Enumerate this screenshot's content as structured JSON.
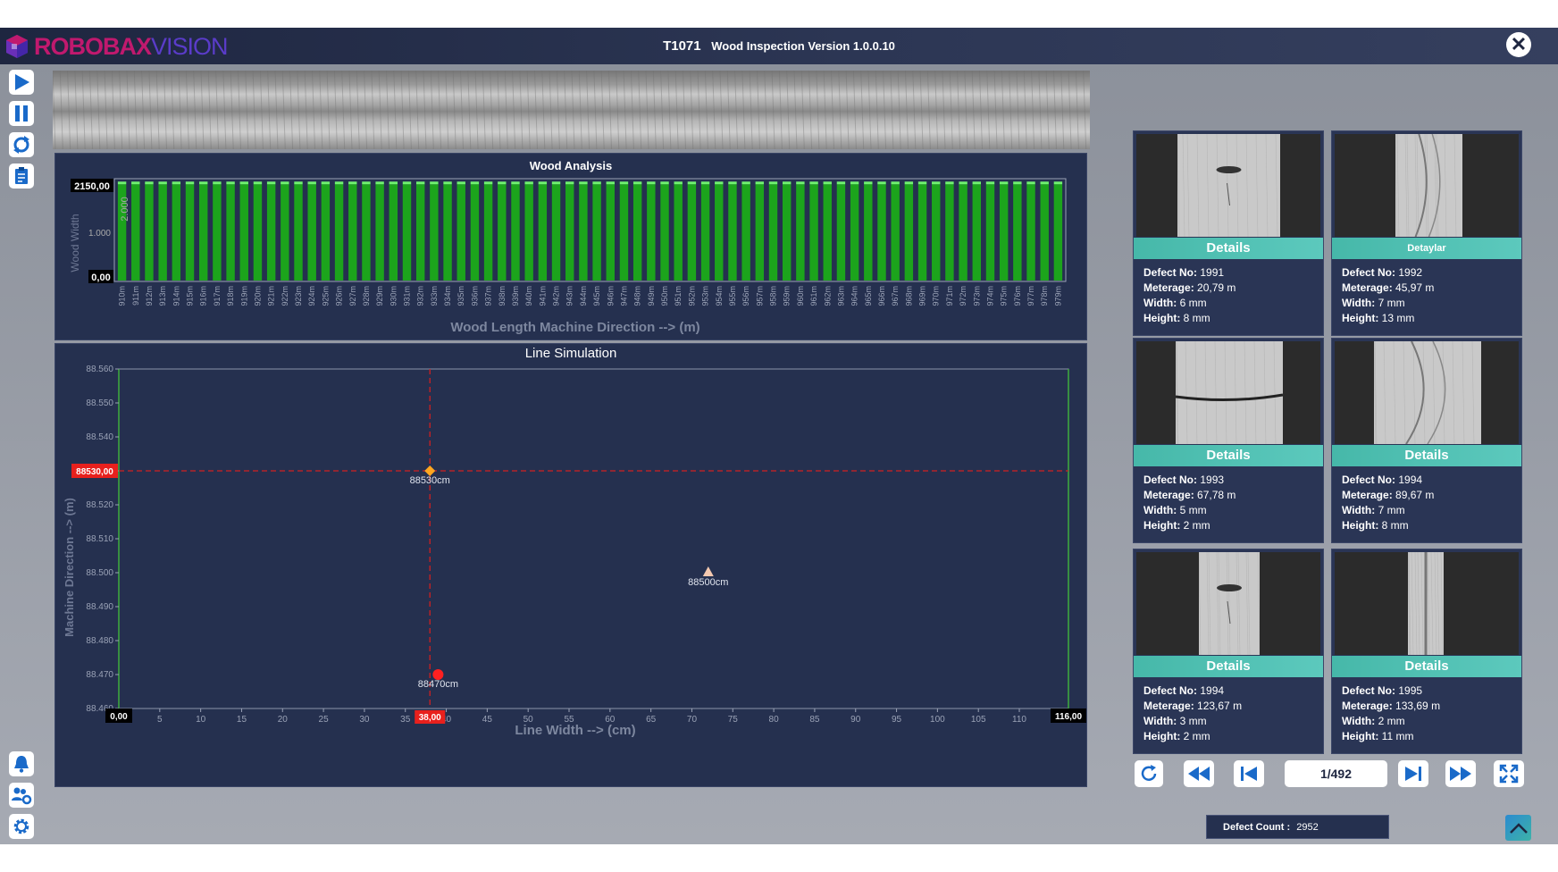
{
  "app": {
    "logo_primary": "ROBOBAX",
    "logo_secondary": "VISION",
    "code": "T1071",
    "title": "Wood Inspection Version 1.0.0.10",
    "close_label": "✕"
  },
  "sidebar": {
    "icons": [
      "play-icon",
      "pause-icon",
      "refresh-icon",
      "report-icon",
      "bell-icon",
      "users-settings-icon",
      "gear-icon"
    ]
  },
  "wood_analysis": {
    "title": "Wood Analysis",
    "ylabel": "Wood Width",
    "xlabel": "Wood Length Machine Direction --> (m)",
    "y_max_label": "2150,00",
    "y_min_label": "0,00",
    "y_mid_label": "1.000",
    "y_top_hidden": "2.000",
    "bar_color": "#1ca41c",
    "bar_top_color": "#6ff06f"
  },
  "chart_data": [
    {
      "type": "bar",
      "title": "Wood Analysis",
      "xlabel": "Wood Length Machine Direction --> (m)",
      "ylabel": "Wood Width",
      "ylim": [
        0,
        2150
      ],
      "categories": [
        "910m",
        "911m",
        "912m",
        "913m",
        "914m",
        "915m",
        "916m",
        "917m",
        "918m",
        "919m",
        "920m",
        "921m",
        "922m",
        "923m",
        "924m",
        "925m",
        "926m",
        "927m",
        "928m",
        "929m",
        "930m",
        "931m",
        "932m",
        "933m",
        "934m",
        "935m",
        "936m",
        "937m",
        "938m",
        "939m",
        "940m",
        "941m",
        "942m",
        "943m",
        "944m",
        "945m",
        "946m",
        "947m",
        "948m",
        "949m",
        "950m",
        "951m",
        "952m",
        "953m",
        "954m",
        "955m",
        "956m",
        "957m",
        "958m",
        "959m",
        "960m",
        "961m",
        "962m",
        "963m",
        "964m",
        "965m",
        "966m",
        "967m",
        "968m",
        "969m",
        "970m",
        "971m",
        "972m",
        "973m",
        "974m",
        "975m",
        "976m",
        "977m",
        "978m",
        "979m"
      ],
      "bar_value": 2050
    },
    {
      "type": "scatter",
      "title": "Line Simulation",
      "xlabel": "Line Width --> (cm)",
      "ylabel": "Machine Direction --> (m)",
      "xlim": [
        0,
        116
      ],
      "ylim": [
        88.46,
        88.56
      ],
      "x_end_label": "116,00",
      "x_start_label": "0,00",
      "x_ticks": [
        5,
        10,
        15,
        20,
        25,
        30,
        35,
        40,
        45,
        50,
        55,
        60,
        65,
        70,
        75,
        80,
        85,
        90,
        95,
        100,
        105,
        110
      ],
      "y_ticks": [
        "88.560",
        "88.550",
        "88.540",
        "88.530",
        "88.520",
        "88.510",
        "88.500",
        "88.490",
        "88.480",
        "88.470",
        "88.460"
      ],
      "cursor": {
        "x": 38,
        "y": 88.53,
        "x_label": "38,00",
        "y_label": "88530,00"
      },
      "points": [
        {
          "x": 38,
          "y": 88.53,
          "label": "88530cm",
          "shape": "diamond",
          "color": "#ffa620"
        },
        {
          "x": 72,
          "y": 88.5,
          "label": "88500cm",
          "shape": "triangle",
          "color": "#f4c9b0"
        },
        {
          "x": 39,
          "y": 88.47,
          "label": "88470cm",
          "shape": "circle",
          "color": "#ff2020"
        }
      ]
    }
  ],
  "defects": [
    {
      "details": "Details",
      "no": "1991",
      "meterage": "20,79 m",
      "width": "6 mm",
      "height": "8 mm"
    },
    {
      "details": "Detaylar",
      "no": "1992",
      "meterage": "45,97 m",
      "width": "7 mm",
      "height": "13 mm"
    },
    {
      "details": "Details",
      "no": "1993",
      "meterage": "67,78 m",
      "width": "5 mm",
      "height": "2 mm"
    },
    {
      "details": "Details",
      "no": "1994",
      "meterage": "89,67 m",
      "width": "7 mm",
      "height": "8 mm"
    },
    {
      "details": "Details",
      "no": "1994",
      "meterage": "123,67 m",
      "width": "3 mm",
      "height": "2 mm"
    },
    {
      "details": "Details",
      "no": "1995",
      "meterage": "133,69 m",
      "width": "2 mm",
      "height": "11 mm"
    }
  ],
  "labels": {
    "defect_no": "Defect No:",
    "meterage": "Meterage:",
    "width": "Width:",
    "height": "Height:"
  },
  "pager": {
    "counter": "1/492"
  },
  "footer": {
    "defect_count_label": "Defect Count :",
    "defect_count": "2952"
  }
}
